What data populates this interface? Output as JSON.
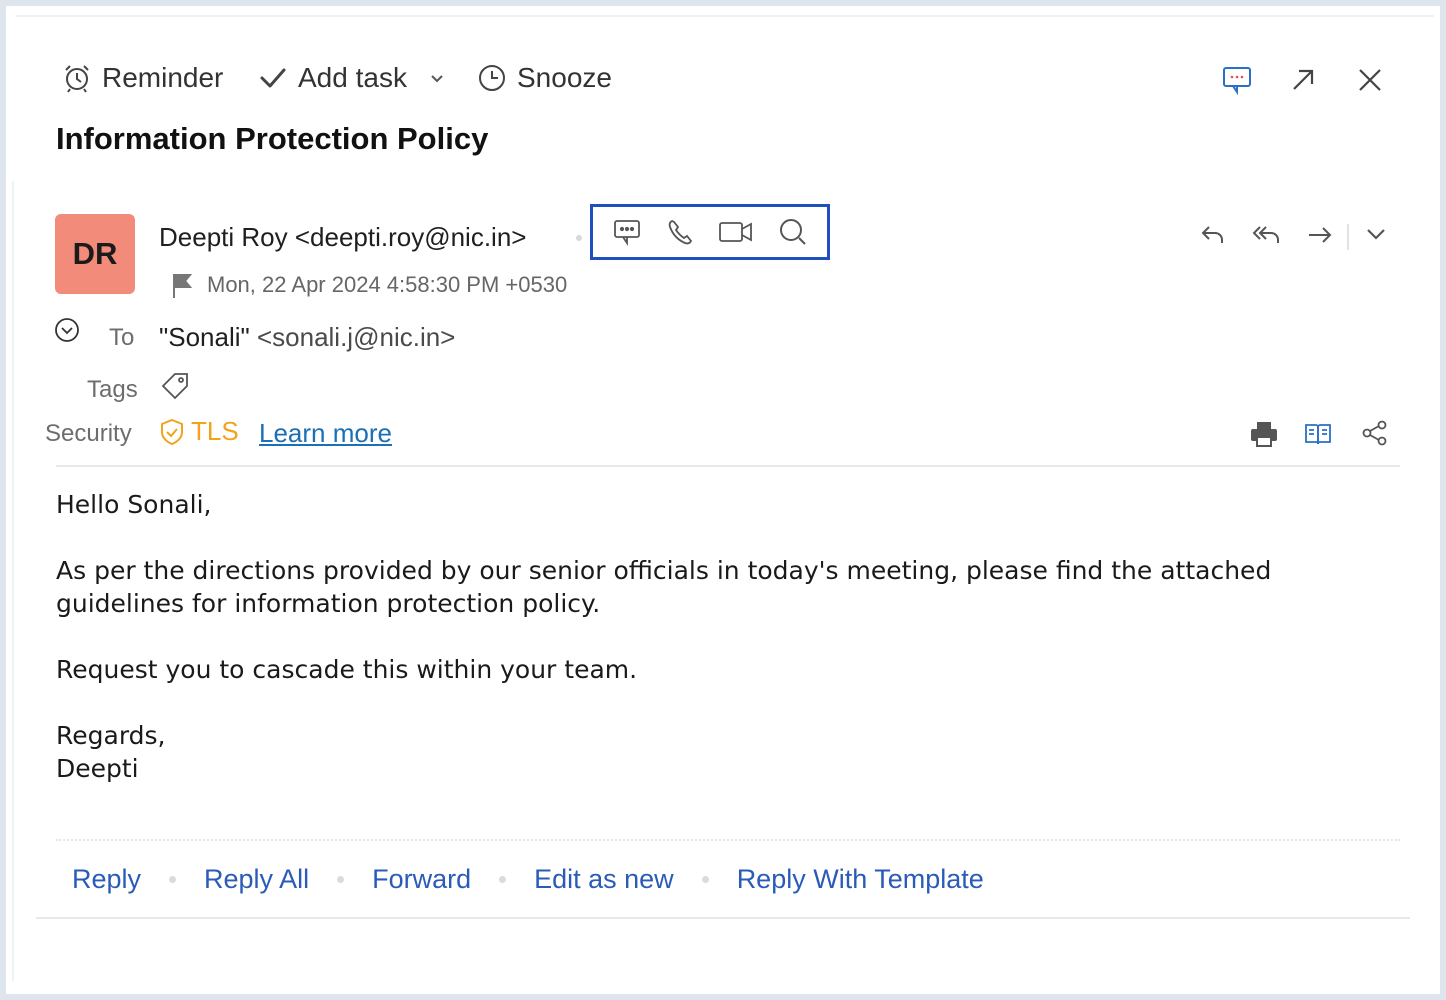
{
  "toolbar": {
    "reminder_label": "Reminder",
    "add_task_label": "Add task",
    "snooze_label": "Snooze"
  },
  "mail": {
    "subject": "Information Protection Policy",
    "avatar_initials": "DR",
    "sender": "Deepti Roy <deepti.roy@nic.in>",
    "date": "Mon, 22 Apr 2024 4:58:30 PM +0530",
    "to_label": "To",
    "to_name": "\"Sonali\"",
    "to_email": "<sonali.j@nic.in>",
    "tags_label": "Tags",
    "security_label": "Security",
    "security_value": "TLS",
    "learn_more": "Learn more",
    "body": {
      "greeting": "Hello Sonali,",
      "paragraph1": "As per the directions provided by our senior officials in today's meeting, please find the attached guidelines for information protection policy.",
      "paragraph2": "Request you to cascade this within your team.",
      "closing": "Regards,",
      "signature": "Deepti"
    }
  },
  "actions": {
    "reply": "Reply",
    "reply_all": "Reply All",
    "forward": "Forward",
    "edit_as_new": "Edit as new",
    "reply_with_template": "Reply With Template"
  },
  "colors": {
    "accent_link": "#2a5bb8",
    "avatar_bg": "#f28b7a",
    "tls": "#f2a31b",
    "highlight_box": "#1f4fbf"
  },
  "icons": {
    "toolbar": [
      "alarm-clock-icon",
      "check-icon",
      "chevron-down-icon",
      "clock-icon"
    ],
    "window": [
      "chat-icon",
      "pop-out-icon",
      "close-icon"
    ],
    "quick_contact": [
      "chat-icon",
      "phone-icon",
      "video-icon",
      "search-icon"
    ],
    "mail_actions": [
      "reply-icon",
      "reply-all-icon",
      "forward-icon",
      "chevron-down-icon"
    ],
    "utility": [
      "print-icon",
      "reader-icon",
      "share-icon"
    ]
  }
}
